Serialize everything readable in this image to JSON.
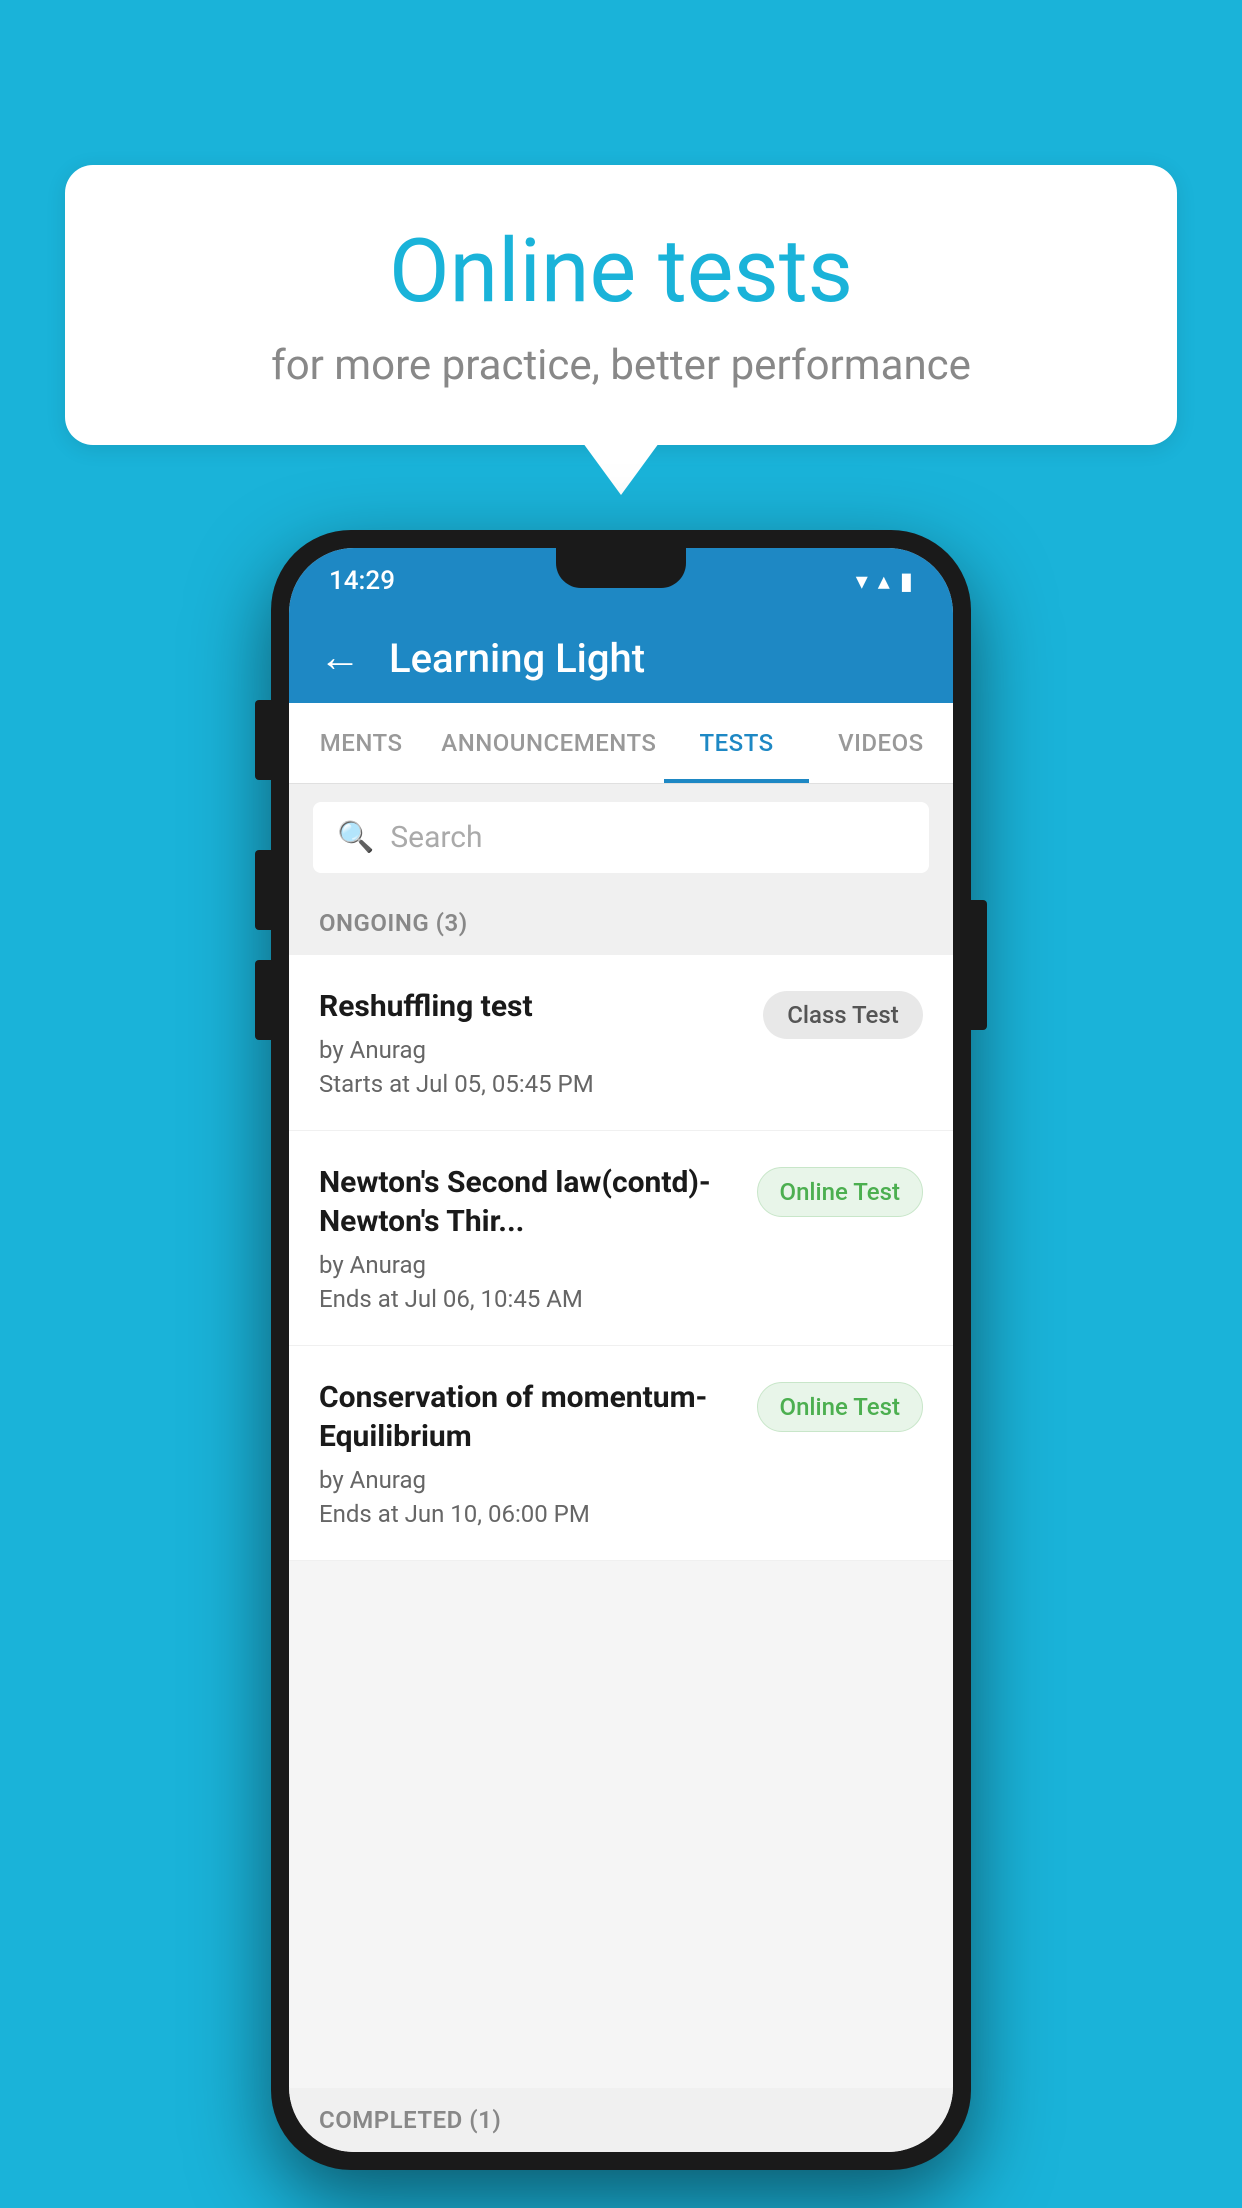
{
  "background": {
    "color": "#1ab3d9"
  },
  "speech_bubble": {
    "title": "Online tests",
    "subtitle": "for more practice, better performance"
  },
  "status_bar": {
    "time": "14:29",
    "wifi_icon": "▼",
    "signal_icon": "▲",
    "battery_icon": "▮"
  },
  "app_header": {
    "back_label": "←",
    "title": "Learning Light"
  },
  "tabs": [
    {
      "label": "MENTS",
      "active": false
    },
    {
      "label": "ANNOUNCEMENTS",
      "active": false
    },
    {
      "label": "TESTS",
      "active": true
    },
    {
      "label": "VIDEOS",
      "active": false
    }
  ],
  "search": {
    "placeholder": "Search"
  },
  "ongoing_section": {
    "label": "ONGOING (3)"
  },
  "tests": [
    {
      "name": "Reshuffling test",
      "author": "by Anurag",
      "date": "Starts at  Jul 05, 05:45 PM",
      "badge": "Class Test",
      "badge_type": "class"
    },
    {
      "name": "Newton's Second law(contd)-Newton's Thir...",
      "author": "by Anurag",
      "date": "Ends at  Jul 06, 10:45 AM",
      "badge": "Online Test",
      "badge_type": "online"
    },
    {
      "name": "Conservation of momentum-Equilibrium",
      "author": "by Anurag",
      "date": "Ends at  Jun 10, 06:00 PM",
      "badge": "Online Test",
      "badge_type": "online"
    }
  ],
  "completed_section": {
    "label": "COMPLETED (1)"
  }
}
